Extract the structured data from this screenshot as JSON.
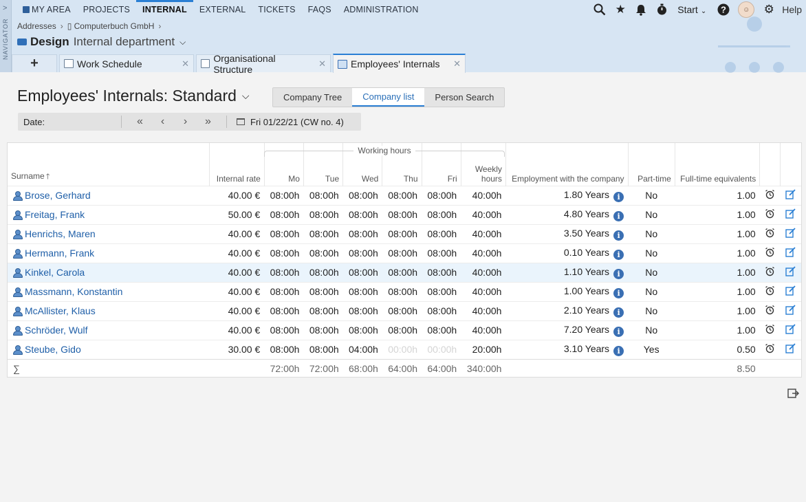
{
  "navigator": {
    "label": "NAVIGATOR",
    "chevron": ">"
  },
  "topnav": {
    "items": [
      {
        "label": "MY AREA",
        "active": false
      },
      {
        "label": "PROJECTS",
        "active": false
      },
      {
        "label": "INTERNAL",
        "active": true
      },
      {
        "label": "EXTERNAL",
        "active": false
      },
      {
        "label": "TICKETS",
        "active": false
      },
      {
        "label": "FAQS",
        "active": false
      },
      {
        "label": "ADMINISTRATION",
        "active": false
      }
    ],
    "start_label": "Start",
    "help_label": "Help"
  },
  "breadcrumb": {
    "items": [
      "Addresses",
      "Computerbuch GmbH"
    ]
  },
  "header": {
    "title_bold": "Design",
    "title_light": "Internal department"
  },
  "tabs": [
    {
      "label": "Work Schedule"
    },
    {
      "label": "Organisational Structure"
    },
    {
      "label": "Employees' Internals"
    }
  ],
  "page": {
    "title": "Employees' Internals: Standard",
    "segments": [
      "Company Tree",
      "Company list",
      "Person Search"
    ],
    "active_segment": 1
  },
  "datebar": {
    "label": "Date:",
    "nav": [
      "«",
      "‹",
      "›",
      "»"
    ],
    "value": "Fri 01/22/21 (CW no. 4)"
  },
  "table": {
    "group_label": "Working hours",
    "headers": {
      "surname": "Surname",
      "rate": "Internal rate",
      "mo": "Mo",
      "tue": "Tue",
      "wed": "Wed",
      "thu": "Thu",
      "fri": "Fri",
      "weekly_1": "Weekly",
      "weekly_2": "hours",
      "employment": "Employment with the company",
      "parttime": "Part-time",
      "fte": "Full-time equivalents"
    },
    "rows": [
      {
        "name": "Brose, Gerhard",
        "rate": "40.00 €",
        "mo": "08:00h",
        "tue": "08:00h",
        "wed": "08:00h",
        "thu": "08:00h",
        "fri": "08:00h",
        "weekly": "40:00h",
        "employment": "1.80 Years",
        "parttime": "No",
        "fte": "1.00"
      },
      {
        "name": "Freitag, Frank",
        "rate": "50.00 €",
        "mo": "08:00h",
        "tue": "08:00h",
        "wed": "08:00h",
        "thu": "08:00h",
        "fri": "08:00h",
        "weekly": "40:00h",
        "employment": "4.80 Years",
        "parttime": "No",
        "fte": "1.00"
      },
      {
        "name": "Henrichs, Maren",
        "rate": "40.00 €",
        "mo": "08:00h",
        "tue": "08:00h",
        "wed": "08:00h",
        "thu": "08:00h",
        "fri": "08:00h",
        "weekly": "40:00h",
        "employment": "3.50 Years",
        "parttime": "No",
        "fte": "1.00"
      },
      {
        "name": "Hermann, Frank",
        "rate": "40.00 €",
        "mo": "08:00h",
        "tue": "08:00h",
        "wed": "08:00h",
        "thu": "08:00h",
        "fri": "08:00h",
        "weekly": "40:00h",
        "employment": "0.10 Years",
        "parttime": "No",
        "fte": "1.00"
      },
      {
        "name": "Kinkel, Carola",
        "rate": "40.00 €",
        "mo": "08:00h",
        "tue": "08:00h",
        "wed": "08:00h",
        "thu": "08:00h",
        "fri": "08:00h",
        "weekly": "40:00h",
        "employment": "1.10 Years",
        "parttime": "No",
        "fte": "1.00"
      },
      {
        "name": "Massmann, Konstantin",
        "rate": "40.00 €",
        "mo": "08:00h",
        "tue": "08:00h",
        "wed": "08:00h",
        "thu": "08:00h",
        "fri": "08:00h",
        "weekly": "40:00h",
        "employment": "1.00 Years",
        "parttime": "No",
        "fte": "1.00"
      },
      {
        "name": "McAllister, Klaus",
        "rate": "40.00 €",
        "mo": "08:00h",
        "tue": "08:00h",
        "wed": "08:00h",
        "thu": "08:00h",
        "fri": "08:00h",
        "weekly": "40:00h",
        "employment": "2.10 Years",
        "parttime": "No",
        "fte": "1.00"
      },
      {
        "name": "Schröder, Wulf",
        "rate": "40.00 €",
        "mo": "08:00h",
        "tue": "08:00h",
        "wed": "08:00h",
        "thu": "08:00h",
        "fri": "08:00h",
        "weekly": "40:00h",
        "employment": "7.20 Years",
        "parttime": "No",
        "fte": "1.00"
      },
      {
        "name": "Steube, Gido",
        "rate": "30.00 €",
        "mo": "08:00h",
        "tue": "08:00h",
        "wed": "04:00h",
        "thu": "00:00h",
        "fri": "00:00h",
        "weekly": "20:00h",
        "employment": "3.10 Years",
        "parttime": "Yes",
        "fte": "0.50"
      }
    ],
    "sum": {
      "symbol": "∑",
      "mo": "72:00h",
      "tue": "72:00h",
      "wed": "68:00h",
      "thu": "64:00h",
      "fri": "64:00h",
      "weekly": "340:00h",
      "fte": "8.50"
    },
    "highlight_row": 4
  },
  "colors": {
    "accent": "#2a7fd4",
    "header_bg": "#d7e5f3",
    "link": "#1f5fa8"
  }
}
